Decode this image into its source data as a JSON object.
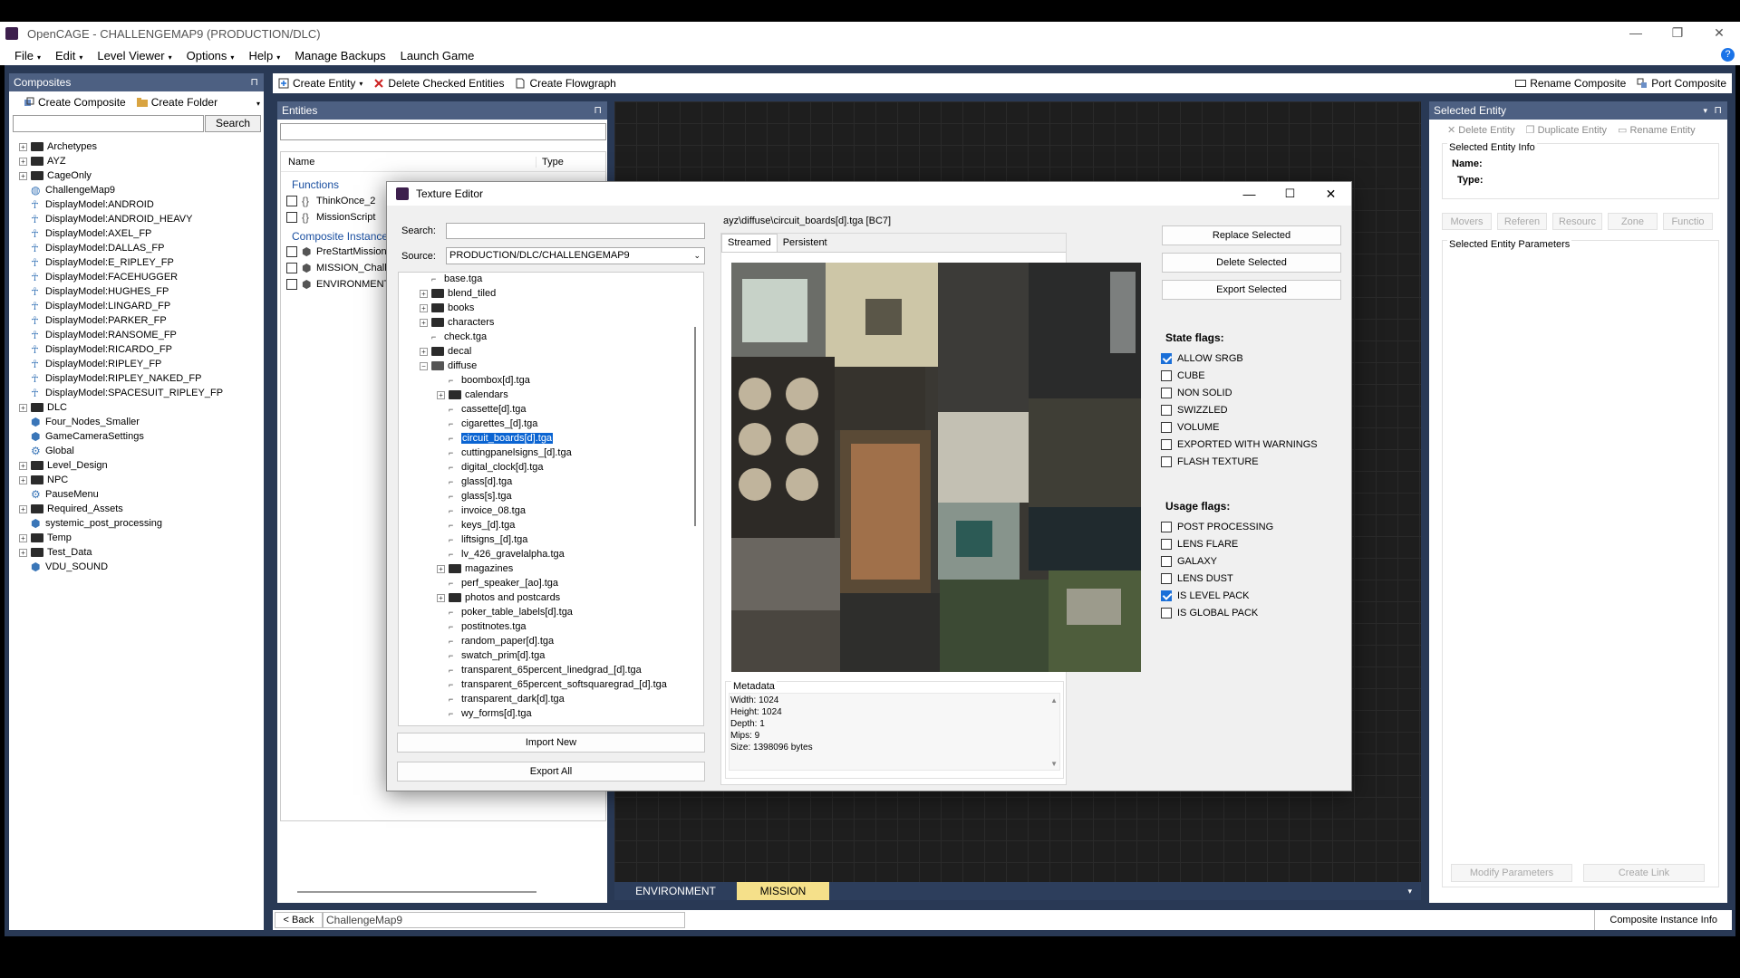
{
  "window": {
    "title": "OpenCAGE - CHALLENGEMAP9 (PRODUCTION/DLC)",
    "minimize": "—",
    "maximize": "❐",
    "close": "✕"
  },
  "menu": [
    {
      "label": "File",
      "caret": "▾"
    },
    {
      "label": "Edit",
      "caret": "▾"
    },
    {
      "label": "Level Viewer",
      "caret": "▾"
    },
    {
      "label": "Options",
      "caret": "▾"
    },
    {
      "label": "Help",
      "caret": "▾"
    },
    {
      "label": "Manage Backups",
      "caret": ""
    },
    {
      "label": "Launch Game",
      "caret": ""
    }
  ],
  "help_icon": "?",
  "composites": {
    "title": "Composites",
    "pin": "⊓",
    "create_composite": "Create Composite",
    "create_folder": "Create Folder",
    "search_button": "Search",
    "search_value": "",
    "items": [
      {
        "label": "Archetypes",
        "kind": "folder",
        "exp": "+"
      },
      {
        "label": "AYZ",
        "kind": "folder",
        "exp": "+"
      },
      {
        "label": "CageOnly",
        "kind": "folder",
        "exp": "+"
      },
      {
        "label": "ChallengeMap9",
        "kind": "globe",
        "exp": ""
      },
      {
        "label": "DisplayModel:ANDROID",
        "kind": "figure",
        "exp": ""
      },
      {
        "label": "DisplayModel:ANDROID_HEAVY",
        "kind": "figure",
        "exp": ""
      },
      {
        "label": "DisplayModel:AXEL_FP",
        "kind": "figure",
        "exp": ""
      },
      {
        "label": "DisplayModel:DALLAS_FP",
        "kind": "figure",
        "exp": ""
      },
      {
        "label": "DisplayModel:E_RIPLEY_FP",
        "kind": "figure",
        "exp": ""
      },
      {
        "label": "DisplayModel:FACEHUGGER",
        "kind": "figure",
        "exp": ""
      },
      {
        "label": "DisplayModel:HUGHES_FP",
        "kind": "figure",
        "exp": ""
      },
      {
        "label": "DisplayModel:LINGARD_FP",
        "kind": "figure",
        "exp": ""
      },
      {
        "label": "DisplayModel:PARKER_FP",
        "kind": "figure",
        "exp": ""
      },
      {
        "label": "DisplayModel:RANSOME_FP",
        "kind": "figure",
        "exp": ""
      },
      {
        "label": "DisplayModel:RICARDO_FP",
        "kind": "figure",
        "exp": ""
      },
      {
        "label": "DisplayModel:RIPLEY_FP",
        "kind": "figure",
        "exp": ""
      },
      {
        "label": "DisplayModel:RIPLEY_NAKED_FP",
        "kind": "figure",
        "exp": ""
      },
      {
        "label": "DisplayModel:SPACESUIT_RIPLEY_FP",
        "kind": "figure",
        "exp": ""
      },
      {
        "label": "DLC",
        "kind": "folder",
        "exp": "+"
      },
      {
        "label": "Four_Nodes_Smaller",
        "kind": "cube",
        "exp": ""
      },
      {
        "label": "GameCameraSettings",
        "kind": "cube",
        "exp": ""
      },
      {
        "label": "Global",
        "kind": "gear",
        "exp": ""
      },
      {
        "label": "Level_Design",
        "kind": "folder",
        "exp": "+"
      },
      {
        "label": "NPC",
        "kind": "folder",
        "exp": "+"
      },
      {
        "label": "PauseMenu",
        "kind": "gear",
        "exp": ""
      },
      {
        "label": "Required_Assets",
        "kind": "folder",
        "exp": "+"
      },
      {
        "label": "systemic_post_processing",
        "kind": "cube",
        "exp": ""
      },
      {
        "label": "Temp",
        "kind": "folder",
        "exp": "+"
      },
      {
        "label": "Test_Data",
        "kind": "folder",
        "exp": "+"
      },
      {
        "label": "VDU_SOUND",
        "kind": "cube",
        "exp": ""
      }
    ]
  },
  "toolbar": {
    "create_entity": "Create Entity",
    "delete_checked": "Delete Checked Entities",
    "create_flowgraph": "Create Flowgraph",
    "rename_composite": "Rename Composite",
    "port_composite": "Port Composite"
  },
  "entities": {
    "title": "Entities",
    "filter_value": "",
    "col_name": "Name",
    "col_type": "Type",
    "group_functions": "Functions",
    "functions": [
      "ThinkOnce_2",
      "MissionScript"
    ],
    "group_instances": "Composite Instance",
    "instances": [
      "PreStartMissionS",
      "MISSION_Challe",
      "ENVIRONMENT"
    ]
  },
  "texture_editor": {
    "title": "Texture Editor",
    "search_label": "Search:",
    "search_value": "",
    "source_label": "Source:",
    "source_value": "PRODUCTION/DLC/CHALLENGEMAP9",
    "tree": [
      {
        "label": "base.tga",
        "indent": 1,
        "kind": "file",
        "exp": ""
      },
      {
        "label": "blend_tiled",
        "indent": 1,
        "kind": "folder",
        "exp": "+"
      },
      {
        "label": "books",
        "indent": 1,
        "kind": "folder",
        "exp": "+"
      },
      {
        "label": "characters",
        "indent": 1,
        "kind": "folder",
        "exp": "+"
      },
      {
        "label": "check.tga",
        "indent": 1,
        "kind": "file",
        "exp": ""
      },
      {
        "label": "decal",
        "indent": 1,
        "kind": "folder",
        "exp": "+"
      },
      {
        "label": "diffuse",
        "indent": 1,
        "kind": "folder-open",
        "exp": "−"
      },
      {
        "label": "boombox[d].tga",
        "indent": 2,
        "kind": "file",
        "exp": ""
      },
      {
        "label": "calendars",
        "indent": 2,
        "kind": "folder",
        "exp": "+"
      },
      {
        "label": "cassette[d].tga",
        "indent": 2,
        "kind": "file",
        "exp": ""
      },
      {
        "label": "cigarettes_[d].tga",
        "indent": 2,
        "kind": "file",
        "exp": ""
      },
      {
        "label": "circuit_boards[d].tga",
        "indent": 2,
        "kind": "file",
        "exp": "",
        "selected": true
      },
      {
        "label": "cuttingpanelsigns_[d].tga",
        "indent": 2,
        "kind": "file",
        "exp": ""
      },
      {
        "label": "digital_clock[d].tga",
        "indent": 2,
        "kind": "file",
        "exp": ""
      },
      {
        "label": "glass[d].tga",
        "indent": 2,
        "kind": "file",
        "exp": ""
      },
      {
        "label": "glass[s].tga",
        "indent": 2,
        "kind": "file",
        "exp": ""
      },
      {
        "label": "invoice_08.tga",
        "indent": 2,
        "kind": "file",
        "exp": ""
      },
      {
        "label": "keys_[d].tga",
        "indent": 2,
        "kind": "file",
        "exp": ""
      },
      {
        "label": "liftsigns_[d].tga",
        "indent": 2,
        "kind": "file",
        "exp": ""
      },
      {
        "label": "lv_426_gravelalpha.tga",
        "indent": 2,
        "kind": "file",
        "exp": ""
      },
      {
        "label": "magazines",
        "indent": 2,
        "kind": "folder",
        "exp": "+"
      },
      {
        "label": "perf_speaker_[ao].tga",
        "indent": 2,
        "kind": "file",
        "exp": ""
      },
      {
        "label": "photos and postcards",
        "indent": 2,
        "kind": "folder",
        "exp": "+"
      },
      {
        "label": "poker_table_labels[d].tga",
        "indent": 2,
        "kind": "file",
        "exp": ""
      },
      {
        "label": "postitnotes.tga",
        "indent": 2,
        "kind": "file",
        "exp": ""
      },
      {
        "label": "random_paper[d].tga",
        "indent": 2,
        "kind": "file",
        "exp": ""
      },
      {
        "label": "swatch_prim[d].tga",
        "indent": 2,
        "kind": "file",
        "exp": ""
      },
      {
        "label": "transparent_65percent_linedgrad_[d].tga",
        "indent": 2,
        "kind": "file",
        "exp": ""
      },
      {
        "label": "transparent_65percent_softsquaregrad_[d].tga",
        "indent": 2,
        "kind": "file",
        "exp": ""
      },
      {
        "label": "transparent_dark[d].tga",
        "indent": 2,
        "kind": "file",
        "exp": ""
      },
      {
        "label": "wy_forms[d].tga",
        "indent": 2,
        "kind": "file",
        "exp": ""
      }
    ],
    "import_new": "Import New",
    "export_all": "Export All",
    "path_label": "ayz\\diffuse\\circuit_boards[d].tga [BC7]",
    "tab_streamed": "Streamed",
    "tab_persistent": "Persistent",
    "metadata_title": "Metadata",
    "metadata_lines": [
      "Width: 1024",
      "Height: 1024",
      "Depth: 1",
      "Mips: 9",
      "Size: 1398096 bytes"
    ],
    "replace_selected": "Replace Selected",
    "delete_selected": "Delete Selected",
    "export_selected": "Export Selected",
    "state_flags_title": "State flags:",
    "state_flags": [
      {
        "label": "ALLOW SRGB",
        "checked": true
      },
      {
        "label": "CUBE",
        "checked": false
      },
      {
        "label": "NON SOLID",
        "checked": false
      },
      {
        "label": "SWIZZLED",
        "checked": false
      },
      {
        "label": "VOLUME",
        "checked": false
      },
      {
        "label": "EXPORTED WITH WARNINGS",
        "checked": false
      },
      {
        "label": "FLASH TEXTURE",
        "checked": false
      }
    ],
    "usage_flags_title": "Usage flags:",
    "usage_flags": [
      {
        "label": "POST PROCESSING",
        "checked": false
      },
      {
        "label": "LENS FLARE",
        "checked": false
      },
      {
        "label": "GALAXY",
        "checked": false
      },
      {
        "label": "LENS DUST",
        "checked": false
      },
      {
        "label": "IS LEVEL PACK",
        "checked": true
      },
      {
        "label": "IS GLOBAL PACK",
        "checked": false
      }
    ]
  },
  "canvas_tabs": {
    "environment": "ENVIRONMENT",
    "mission": "MISSION"
  },
  "bottom": {
    "back": "< Back",
    "breadcrumb": "ChallengeMap9",
    "instance_info": "Composite Instance Info"
  },
  "selected_entity": {
    "title": "Selected Entity",
    "delete_entity": "Delete Entity",
    "duplicate_entity": "Duplicate Entity",
    "rename_entity": "Rename Entity",
    "info_title": "Selected Entity Info",
    "name_label": "Name:",
    "type_label": "Type:",
    "tabs": [
      "Movers",
      "Referen",
      "Resourc",
      "Zone",
      "Functio"
    ],
    "params_title": "Selected Entity Parameters",
    "modify_parameters": "Modify Parameters",
    "create_link": "Create Link"
  },
  "colors": {
    "panel_header": "#4d6082",
    "workspace": "#293955",
    "selection": "#0a64d2",
    "mission_tab": "#f5e08a"
  }
}
